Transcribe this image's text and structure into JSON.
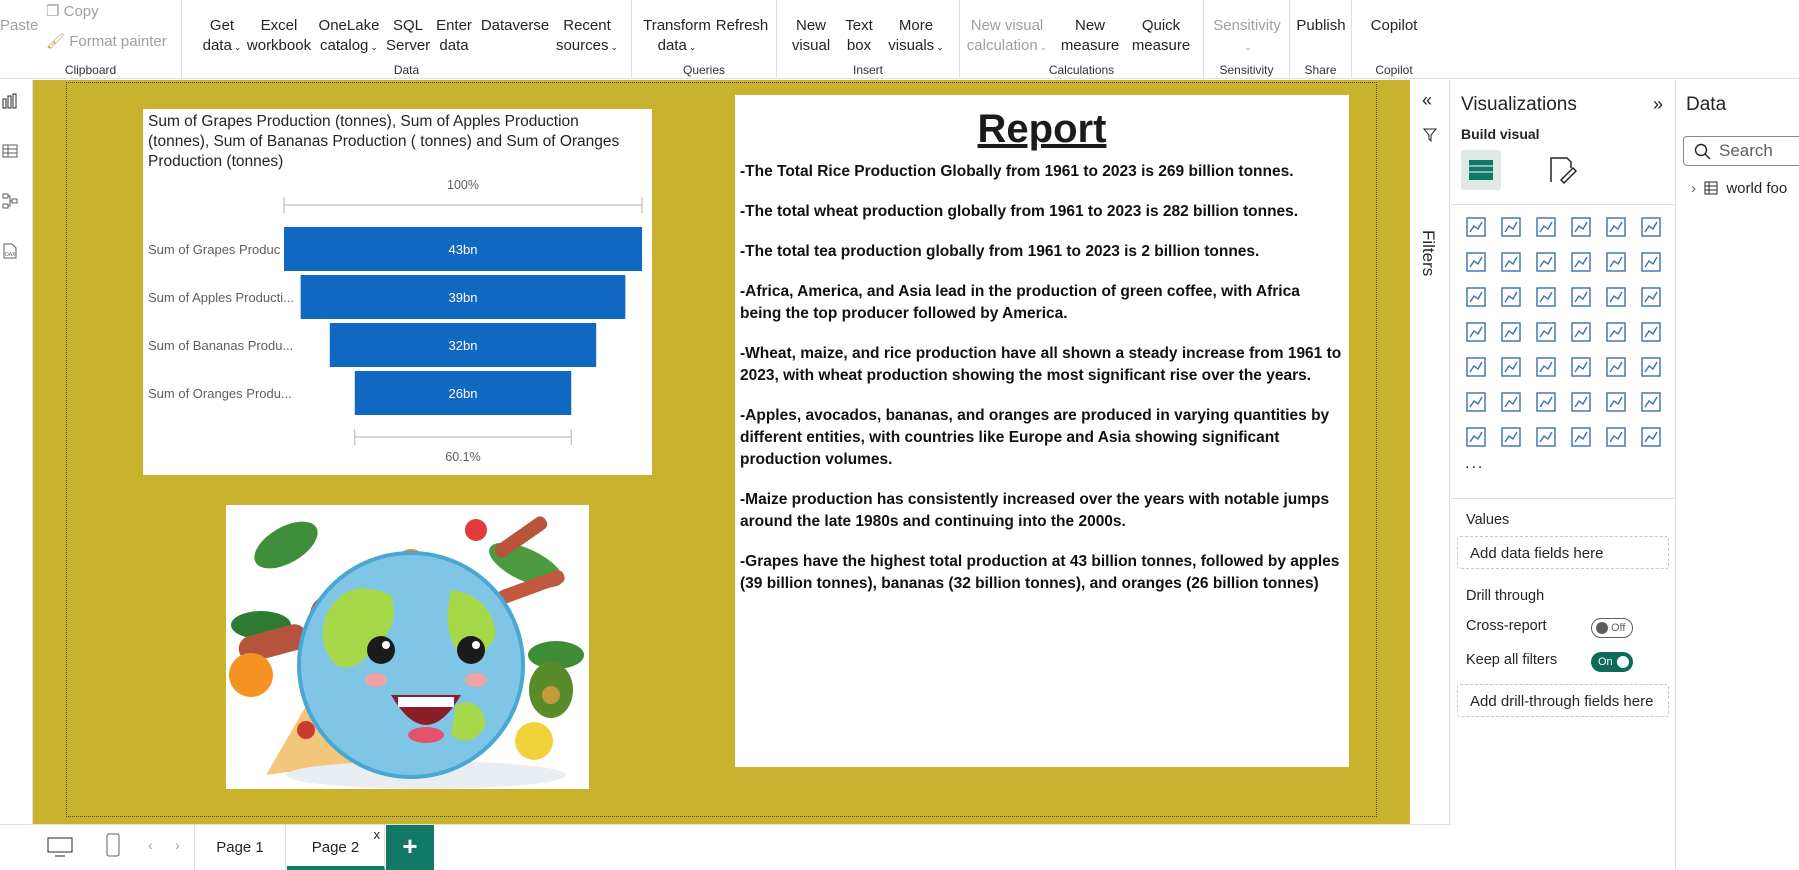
{
  "ribbon": {
    "clipboard": {
      "label": "Clipboard",
      "paste": "Paste",
      "copy": "Copy",
      "format_painter": "Format painter"
    },
    "data": {
      "label": "Data",
      "get_data": [
        "Get",
        "data"
      ],
      "excel": [
        "Excel",
        "workbook"
      ],
      "onelake": [
        "OneLake",
        "catalog"
      ],
      "sql": [
        "SQL",
        "Server"
      ],
      "enter": [
        "Enter",
        "data"
      ],
      "dataverse": [
        "Dataverse",
        ""
      ],
      "recent": [
        "Recent",
        "sources"
      ]
    },
    "queries": {
      "label": "Queries",
      "transform": [
        "Transform",
        "data"
      ],
      "refresh": [
        "Refresh",
        ""
      ]
    },
    "insert": {
      "label": "Insert",
      "new_visual": [
        "New",
        "visual"
      ],
      "text_box": [
        "Text",
        "box"
      ],
      "more_visuals": [
        "More",
        "visuals"
      ]
    },
    "calculations": {
      "label": "Calculations",
      "new_visual_calc": [
        "New visual",
        "calculation"
      ],
      "new_measure": [
        "New",
        "measure"
      ],
      "quick_measure": [
        "Quick",
        "measure"
      ]
    },
    "sensitivity": {
      "label": "Sensitivity",
      "sensitivity": [
        "Sensitivity",
        ""
      ]
    },
    "share": {
      "label": "Share",
      "publish": [
        "Publish",
        ""
      ]
    },
    "copilot": {
      "label": "Copilot",
      "copilot": [
        "Copilot",
        ""
      ]
    }
  },
  "funnel": {
    "title": "Sum of Grapes Production (tonnes), Sum of Apples Production (tonnes), Sum of Bananas Production ( tonnes) and Sum of Oranges Production (tonnes)"
  },
  "chart_data": {
    "type": "funnel",
    "title": "Sum of Grapes Production (tonnes), Sum of Apples Production (tonnes), Sum of Bananas Production ( tonnes) and Sum of Oranges Production (tonnes)",
    "categories": [
      "Sum of Grapes Produc",
      "Sum of Apples Producti...",
      "Sum of Bananas Produ...",
      "Sum of Oranges Produ..."
    ],
    "values": [
      43,
      39,
      32,
      26
    ],
    "data_labels": [
      "43bn",
      "39bn",
      "32bn",
      "26bn"
    ],
    "top_label": "100%",
    "bottom_label": "60.1%",
    "bar_color": "#1168c3"
  },
  "report": {
    "title": "Report",
    "paragraphs": [
      "-The Total Rice Production Globally from 1961 to 2023 is 269 billion tonnes.",
      "-The total wheat production globally from 1961 to 2023 is 282 billion tonnes.",
      "-The total tea production globally from 1961 to 2023 is 2 billion tonnes.",
      "-Africa, America, and Asia lead in the production of green coffee, with Africa being the top producer followed by America.",
      "-Wheat, maize, and rice production have all shown a steady increase from 1961 to 2023, with wheat production showing the most significant rise over the years.",
      "-Apples, avocados, bananas, and oranges are produced in varying quantities by different entities, with countries like Europe and Asia showing significant production volumes.",
      "-Maize production has consistently increased over the years with notable jumps around the late 1980s and continuing into the 2000s.",
      "-Grapes have the highest total production at 43 billion tonnes, followed by apples (39 billion tonnes), bananas (32 billion tonnes), and oranges (26 billion tonnes)"
    ]
  },
  "filters": {
    "label": "Filters"
  },
  "visualizations": {
    "title": "Visualizations",
    "build_visual": "Build visual",
    "more": "...",
    "values_label": "Values",
    "values_well": "Add data fields here",
    "drill_through": "Drill through",
    "cross_report": "Cross-report",
    "cross_report_state": "Off",
    "keep_all_filters": "Keep all filters",
    "keep_all_filters_state": "On",
    "drill_well": "Add drill-through fields here"
  },
  "data_pane": {
    "title": "Data",
    "search_placeholder": "Search",
    "table": "world foo"
  },
  "pages": {
    "tabs": [
      "Page 1",
      "Page 2"
    ],
    "close": "x",
    "add": "+"
  },
  "colors": {
    "canvas": "#c9b22e",
    "accent": "#117865",
    "bar": "#1168c3"
  }
}
